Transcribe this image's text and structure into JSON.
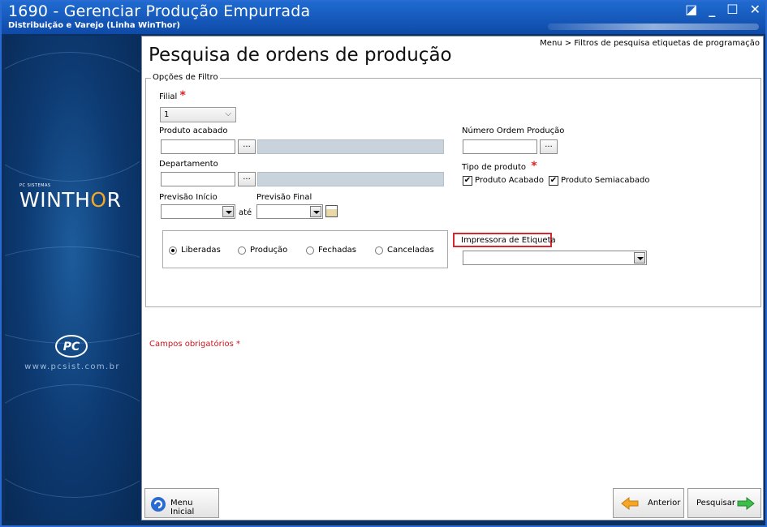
{
  "window": {
    "title": "1690 - Gerenciar Produção Empurrada",
    "subtitle": "Distribuição e Varejo (Linha WinThor)",
    "controls": {
      "minimize": "_",
      "close": "✕"
    }
  },
  "sidebar": {
    "brand_small": "PC SISTEMAS",
    "brand_prefix": "WINTH",
    "brand_o": "O",
    "brand_suffix": "R",
    "logo_text": "PC",
    "site": "www.pcsist.com.br"
  },
  "header": {
    "breadcrumb": "Menu > Filtros de pesquisa etiquetas de programação",
    "page_title": "Pesquisa de ordens de produção"
  },
  "filters": {
    "legend": "Opções de Filtro",
    "filial": {
      "label": "Filial",
      "value": "1"
    },
    "produto_acabado": {
      "label": "Produto acabado",
      "dots": "..."
    },
    "departamento": {
      "label": "Departamento",
      "dots": "..."
    },
    "numero_ordem": {
      "label": "Número Ordem Produção",
      "dots": "..."
    },
    "tipo_produto": {
      "label": "Tipo de produto",
      "options": [
        {
          "label": "Produto Acabado",
          "checked": true
        },
        {
          "label": "Produto Semiacabado",
          "checked": true
        }
      ]
    },
    "previsao_inicio": {
      "label": "Previsão Início"
    },
    "ate": "até",
    "previsao_final": {
      "label": "Previsão Final"
    },
    "status_radios": [
      {
        "label": "Liberadas",
        "selected": true
      },
      {
        "label": "Produção",
        "selected": false
      },
      {
        "label": "Fechadas",
        "selected": false
      },
      {
        "label": "Canceladas",
        "selected": false
      }
    ],
    "impressora": {
      "label": "Impressora de Etiqueta",
      "value": ""
    },
    "required_mark": "*",
    "required_note": "Campos obrigatórios *"
  },
  "footer": {
    "menu_inicial": "Menu Inicial",
    "anterior": "Anterior",
    "pesquisar": "Pesquisar"
  },
  "colors": {
    "accent": "#1f6ad0",
    "required": "#e02020",
    "highlight": "#d7262e",
    "arrow": "#f5a623",
    "go": "#3cbf4a"
  }
}
